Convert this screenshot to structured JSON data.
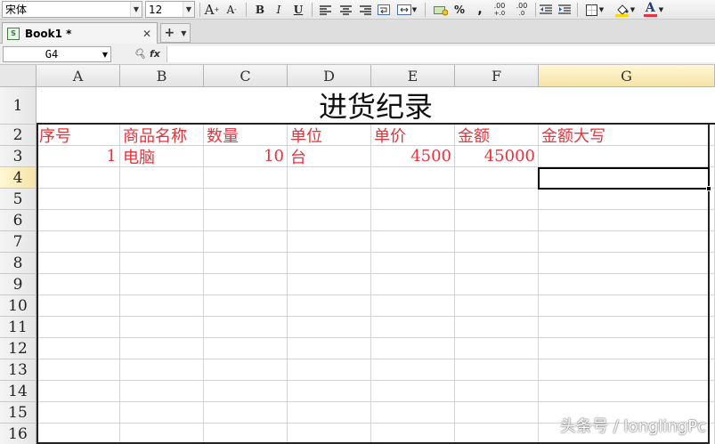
{
  "toolbar": {
    "font_name": "宋体",
    "font_size": "12",
    "increase_font": "A",
    "decrease_font": "A",
    "bold": "B",
    "italic": "I",
    "underline": "U",
    "percent": "%",
    "thousands": ",",
    "inc_decimal": ".00",
    "dec_decimal": ".00",
    "font_color_letter": "A",
    "colors": {
      "font_color": "#e8323c",
      "fill_color": "#ffd800"
    }
  },
  "tab": {
    "title": "Book1 *",
    "close": "✕",
    "new": "+"
  },
  "formula_bar": {
    "cell_ref": "G4",
    "fx": "fx",
    "content": ""
  },
  "columns": [
    "A",
    "B",
    "C",
    "D",
    "E",
    "F",
    "G"
  ],
  "selected_column": "G",
  "rows": [
    "1",
    "2",
    "3",
    "4",
    "5",
    "6",
    "7",
    "8",
    "9",
    "10",
    "11",
    "12",
    "13",
    "14",
    "15",
    "16"
  ],
  "selected_row": "4",
  "sheet": {
    "title": "进货纪录",
    "headers": [
      "序号",
      "商品名称",
      "数量",
      "单位",
      "单价",
      "金额",
      "金额大写"
    ],
    "row3": [
      "1",
      "电脑",
      "10",
      "台",
      "4500",
      "45000",
      ""
    ],
    "text_color": "#e8323c"
  },
  "watermark": "头条号 / longlingPc"
}
